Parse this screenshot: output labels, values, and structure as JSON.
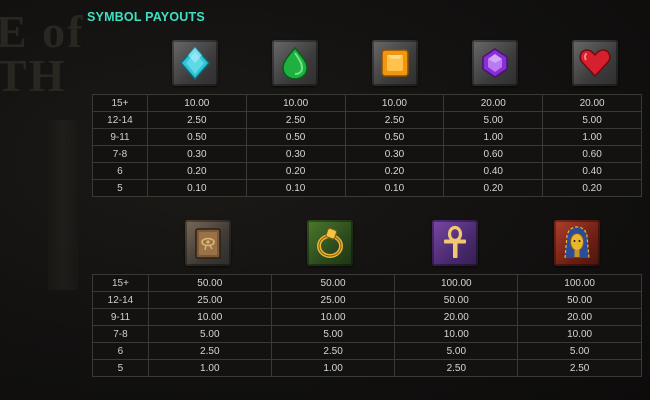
{
  "heading": "SYMBOL PAYOUTS",
  "background_text": [
    "E of",
    "TH"
  ],
  "colors": {
    "heading": "#3ee0c0",
    "grid_line": "#3b3935",
    "text": "#d6d6d6"
  },
  "table1": {
    "symbols": [
      "cyan-gem-icon",
      "green-gem-icon",
      "orange-gem-icon",
      "purple-gem-icon",
      "red-heart-gem-icon"
    ],
    "rows": [
      {
        "label": "15+",
        "values": [
          "10.00",
          "10.00",
          "10.00",
          "20.00",
          "20.00"
        ]
      },
      {
        "label": "12-14",
        "values": [
          "2.50",
          "2.50",
          "2.50",
          "5.00",
          "5.00"
        ]
      },
      {
        "label": "9-11",
        "values": [
          "0.50",
          "0.50",
          "0.50",
          "1.00",
          "1.00"
        ]
      },
      {
        "label": "7-8",
        "values": [
          "0.30",
          "0.30",
          "0.30",
          "0.60",
          "0.60"
        ]
      },
      {
        "label": "6",
        "values": [
          "0.20",
          "0.20",
          "0.20",
          "0.40",
          "0.40"
        ]
      },
      {
        "label": "5",
        "values": [
          "0.10",
          "0.10",
          "0.10",
          "0.20",
          "0.20"
        ]
      }
    ]
  },
  "table2": {
    "symbols": [
      "book-icon",
      "ring-icon",
      "ankh-icon",
      "pharaoh-mask-icon"
    ],
    "rows": [
      {
        "label": "15+",
        "values": [
          "50.00",
          "50.00",
          "100.00",
          "100.00"
        ]
      },
      {
        "label": "12-14",
        "values": [
          "25.00",
          "25.00",
          "50.00",
          "50.00"
        ]
      },
      {
        "label": "9-11",
        "values": [
          "10.00",
          "10.00",
          "20.00",
          "20.00"
        ]
      },
      {
        "label": "7-8",
        "values": [
          "5.00",
          "5.00",
          "10.00",
          "10.00"
        ]
      },
      {
        "label": "6",
        "values": [
          "2.50",
          "2.50",
          "5.00",
          "5.00"
        ]
      },
      {
        "label": "5",
        "values": [
          "1.00",
          "1.00",
          "2.50",
          "2.50"
        ]
      }
    ]
  }
}
